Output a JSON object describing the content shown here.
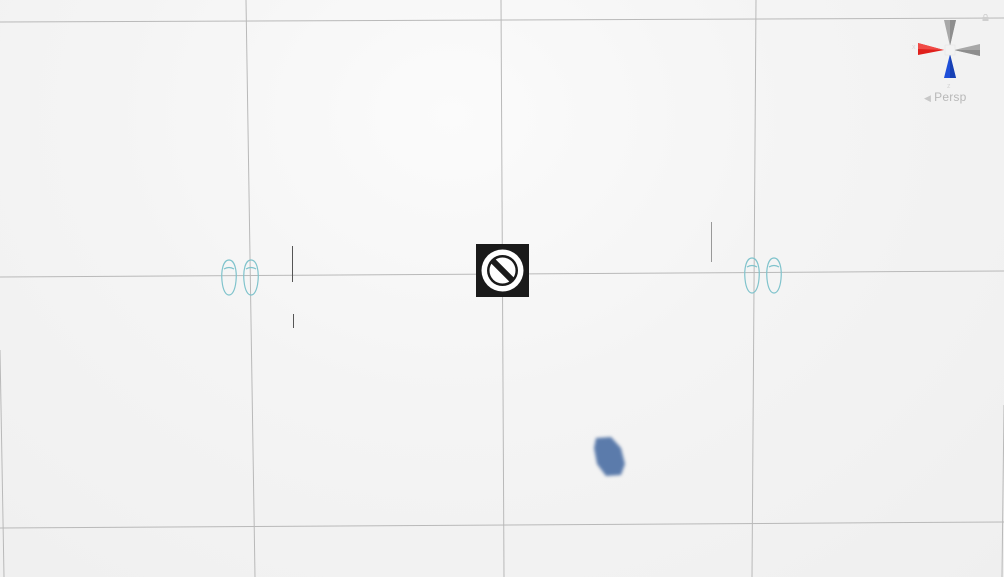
{
  "scene_view": {
    "projection_label": "Persp",
    "colors": {
      "grid": "#b9b9b9",
      "axis_x": "#e0201c",
      "axis_y": "#a8a8a8",
      "axis_z": "#1f4fd9",
      "footprint": "#7fc3cc",
      "blob": "#5b7bab",
      "icon_bg": "#1a1a1a"
    },
    "icons": {
      "center": "prohibited-icon",
      "lock": "lock-icon",
      "footprints": "footprints-icon"
    }
  }
}
